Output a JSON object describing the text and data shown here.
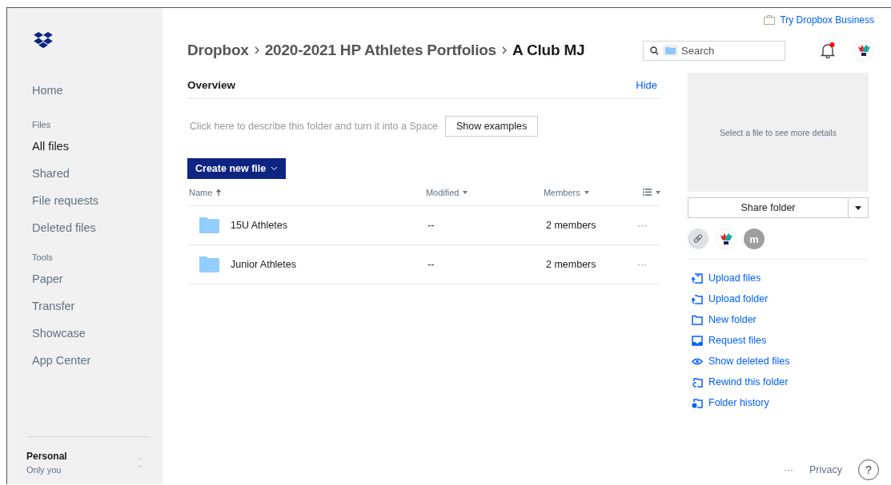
{
  "sidebar": {
    "items": [
      {
        "kind": "item",
        "label": "Home",
        "selected": false
      },
      {
        "kind": "section",
        "label": "Files"
      },
      {
        "kind": "item",
        "label": "All files",
        "selected": true
      },
      {
        "kind": "item",
        "label": "Shared",
        "selected": false
      },
      {
        "kind": "item",
        "label": "File requests",
        "selected": false
      },
      {
        "kind": "item",
        "label": "Deleted files",
        "selected": false
      },
      {
        "kind": "section",
        "label": "Tools"
      },
      {
        "kind": "item",
        "label": "Paper",
        "selected": false
      },
      {
        "kind": "item",
        "label": "Transfer",
        "selected": false
      },
      {
        "kind": "item",
        "label": "Showcase",
        "selected": false
      },
      {
        "kind": "item",
        "label": "App Center",
        "selected": false
      }
    ],
    "account": {
      "name": "Personal",
      "subtitle": "Only you"
    }
  },
  "top_link": "Try Dropbox Business",
  "breadcrumbs": [
    "Dropbox",
    "2020-2021 HP Athletes Portfolios",
    "A Club MJ"
  ],
  "search": {
    "placeholder": "Search"
  },
  "notifications": {
    "unread": true
  },
  "overview": {
    "title": "Overview",
    "hide": "Hide",
    "description": "Click here to describe this folder and turn it into a Space",
    "examples_button": "Show examples"
  },
  "create_button": "Create new file",
  "table": {
    "columns": [
      "Name",
      "Modified",
      "Members"
    ],
    "rows": [
      {
        "name": "15U Athletes",
        "modified": "--",
        "members": "2 members",
        "more": "···"
      },
      {
        "name": "Junior Athletes",
        "modified": "--",
        "members": "2 members",
        "more": "···"
      }
    ]
  },
  "details": {
    "placeholder": "Select a file to see more details",
    "share_button": "Share folder",
    "member_letter": "m"
  },
  "actions": [
    {
      "kind": "upload-file",
      "label": "Upload files"
    },
    {
      "kind": "upload-folder",
      "label": "Upload folder"
    },
    {
      "kind": "new-folder",
      "label": "New folder"
    },
    {
      "kind": "request",
      "label": "Request files"
    },
    {
      "kind": "deleted",
      "label": "Show deleted files"
    },
    {
      "kind": "rewind",
      "label": "Rewind this folder"
    },
    {
      "kind": "history",
      "label": "Folder history"
    }
  ],
  "footer": {
    "more": "···",
    "privacy": "Privacy",
    "help": "?"
  }
}
